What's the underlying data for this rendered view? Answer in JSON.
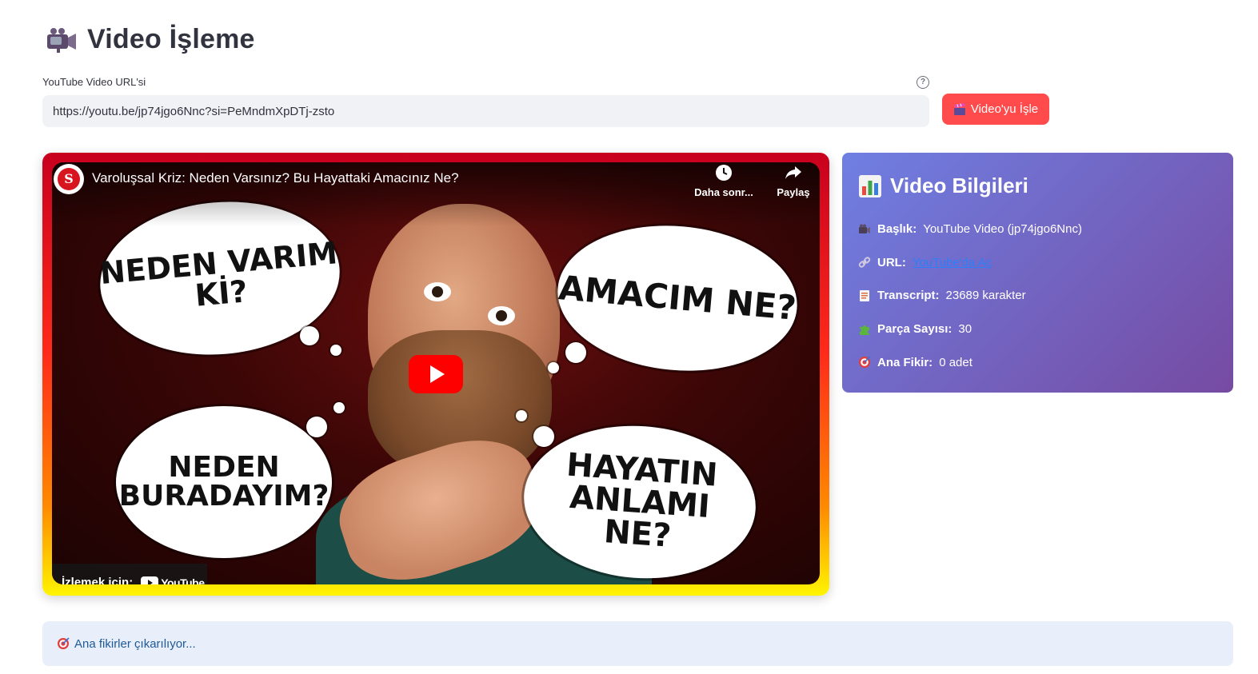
{
  "header": {
    "title": "Video İşleme",
    "icon": "video-camera-icon"
  },
  "url_field": {
    "label": "YouTube Video URL'si",
    "value": "https://youtu.be/jp74jgo6Nnc?si=PeMndmXpDTj-zsto",
    "help_icon": "question-circle-icon"
  },
  "process_button": {
    "label": "Video'yu İşle",
    "icon": "clapperboard-icon",
    "color": "#ff4b4b"
  },
  "video_player": {
    "title": "Varoluşsal Kriz: Neden Varsınız? Bu Hayattaki Amacınız Ne?",
    "watch_later_label": "Daha sonr...",
    "share_label": "Paylaş",
    "watch_on_label": "İzlemek için:",
    "youtube_brand": "YouTube",
    "thumbnail_texts": [
      "NEDEN VARIM Kİ?",
      "AMACIM NE?",
      "NEDEN BURADAYIM?",
      "HAYATIN ANLAMI NE?"
    ]
  },
  "info_card": {
    "title": "Video Bilgileri",
    "title_icon": "bar-chart-icon",
    "gradient": [
      "#6f7fe2",
      "#764ba2"
    ],
    "rows": [
      {
        "icon": "video-camera-icon",
        "key": "Başlık:",
        "value": "YouTube Video (jp74jgo6Nnc)"
      },
      {
        "icon": "link-icon",
        "key": "URL:",
        "value": "YouTube'da Aç"
      },
      {
        "icon": "document-icon",
        "key": "Transcript:",
        "value": "23689 karakter"
      },
      {
        "icon": "puzzle-icon",
        "key": "Parça Sayısı:",
        "value": "30"
      },
      {
        "icon": "target-icon",
        "key": "Ana Fikir:",
        "value": "0 adet"
      }
    ]
  },
  "status": {
    "text": "Ana fikirler çıkarılıyor...",
    "icon": "target-icon"
  }
}
